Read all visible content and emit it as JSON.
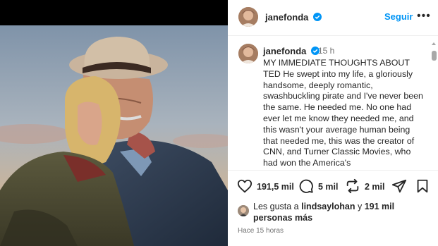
{
  "post": {
    "author": "janefonda",
    "follow_label": "Seguir",
    "caption_author": "janefonda",
    "caption_time": "15 h",
    "caption_text": "MY IMMEDIATE THOUGHTS ABOUT TED He swept into my life, a gloriously handsome, deeply romantic, swashbuckling pirate and I've never been the same. He needed me. No one had ever let me know they needed me, and this wasn't your average human being that needed me, this was the creator of CNN, and Turner Classic Movies, who had won the America's",
    "likes_count": "191,5 mil",
    "comments_count": "5 mil",
    "reposts_count": "2 mil",
    "likes_prefix": "Les gusta a ",
    "likes_user": "lindsaylohan",
    "likes_middle": " y ",
    "likes_others": "191 mil personas más",
    "time_ago": "Hace 15 horas"
  },
  "colors": {
    "accent": "#0095f6",
    "text": "#262626",
    "muted": "#737373",
    "verified": "#0095f6"
  },
  "icons": [
    "verified-badge-icon",
    "more-options-icon",
    "heart-icon",
    "comment-icon",
    "repost-icon",
    "share-icon",
    "bookmark-icon"
  ]
}
